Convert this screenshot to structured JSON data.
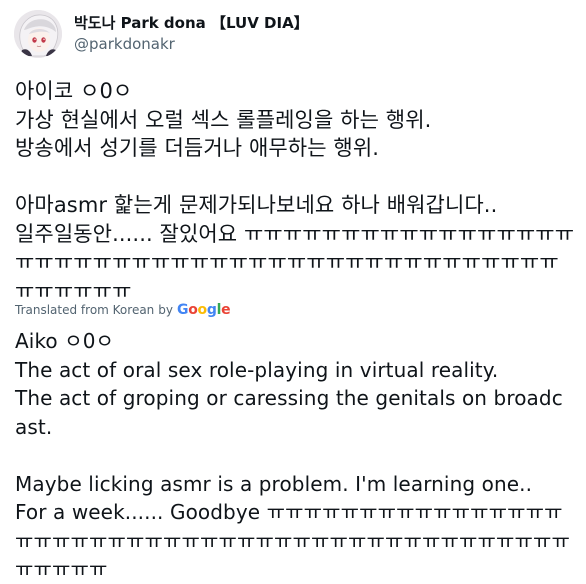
{
  "tweet": {
    "display_name": "박도나 Park dona 【LUV DIA】",
    "handle": "@parkdonakr",
    "original_text": "아이코 ㅇ0ㅇ\n가상 현실에서 오럴 섹스 롤플레잉을 하는 행위.\n방송에서 성기를 더듬거나 애무하는 행위.\n\n아마asmr 핥는게 문제가되나보네요 하나 배워갑니다..\n일주일동안...... 잘있어요 ㅠㅠㅠㅠㅠㅠㅠㅠㅠㅠㅠㅠㅠㅠㅠㅠㅠㅠㅠㅠㅠㅠㅠㅠㅠㅠㅠㅠㅠㅠㅠㅠㅠㅠㅠㅠㅠㅠㅠㅠㅠㅠㅠㅠㅠㅠㅠㅠㅠㅠㅠ",
    "translated_label": "Translated from Korean",
    "translated_by": "by",
    "translated_text": "Aiko ㅇ0ㅇ\nThe act of oral sex role-playing in virtual reality.\nThe act of groping or caressing the genitals on broadcast.\n\nMaybe licking asmr is a problem. I'm learning one..\nFor a week...... Goodbye ㅠㅠㅠㅠㅠㅠㅠㅠㅠㅠㅠㅠㅠㅠㅠㅠㅠㅠㅠㅠㅠㅠㅠㅠㅠㅠㅠㅠㅠㅠㅠㅠㅠㅠㅠㅠㅠㅠㅠㅠㅠㅠㅠㅠㅠㅠㅠㅠㅠㅠㅠ",
    "google_letters": [
      "G",
      "o",
      "o",
      "g",
      "l",
      "e"
    ]
  },
  "colors": {
    "text": "#0f1419",
    "secondary": "#536471",
    "google_blue": "#4285F4",
    "google_red": "#EA4335",
    "google_yellow": "#FBBC05",
    "google_green": "#34A853"
  }
}
